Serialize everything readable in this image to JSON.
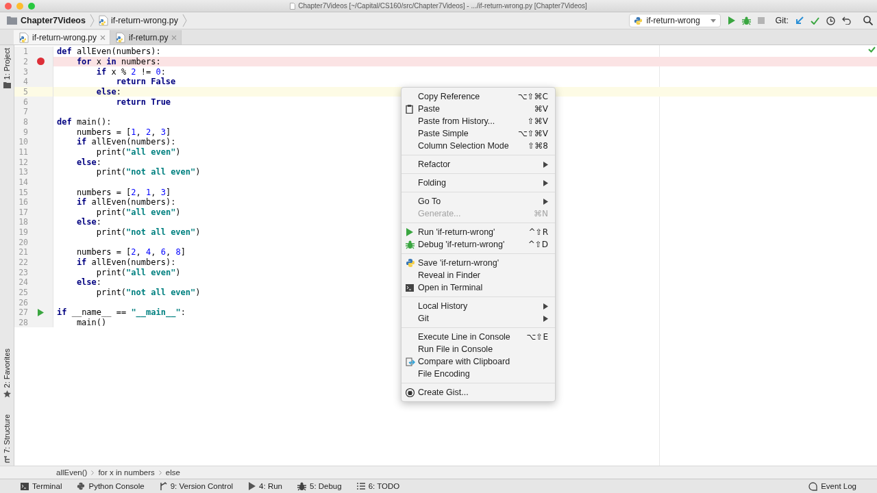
{
  "window": {
    "title": "Chapter7Videos [~/Capital/CS160/src/Chapter7Videos] - .../if-return-wrong.py [Chapter7Videos]"
  },
  "navbar": {
    "crumbs": [
      "Chapter7Videos",
      "if-return-wrong.py"
    ],
    "run_config": "if-return-wrong",
    "git_label": "Git:"
  },
  "tabs": [
    {
      "label": "if-return-wrong.py",
      "selected": true
    },
    {
      "label": "if-return.py",
      "selected": false
    }
  ],
  "side_tools": [
    {
      "kind": "project",
      "label": "1: Project"
    },
    {
      "kind": "favorites",
      "label": "2: Favorites"
    },
    {
      "kind": "structure",
      "label": "7: Structure"
    }
  ],
  "code": [
    {
      "number": "1",
      "tokens": [
        {
          "kind": "kw",
          "text": "def"
        },
        {
          "kind": "plain",
          "text": " allEven(numbers):"
        }
      ],
      "children": [
        {
          "number": "2",
          "breakpoint": true,
          "tokens": [
            {
              "kind": "kw",
              "text": "for"
            },
            {
              "kind": "plain",
              "text": " x "
            },
            {
              "kind": "kw",
              "text": "in"
            },
            {
              "kind": "plain",
              "text": " numbers:"
            }
          ],
          "children": [
            {
              "number": "3",
              "tokens": [
                {
                  "kind": "kw",
                  "text": "if"
                },
                {
                  "kind": "plain",
                  "text": " x % "
                },
                {
                  "kind": "num",
                  "text": "2"
                },
                {
                  "kind": "plain",
                  "text": " != "
                },
                {
                  "kind": "num",
                  "text": "0"
                },
                {
                  "kind": "plain",
                  "text": ":"
                }
              ],
              "children": [
                {
                  "number": "4",
                  "tokens": [
                    {
                      "kind": "kw",
                      "text": "return False"
                    }
                  ]
                }
              ]
            },
            {
              "number": "5",
              "caret_line": true,
              "tokens": [
                {
                  "kind": "kw",
                  "text": "else"
                },
                {
                  "kind": "plain",
                  "text": ":"
                }
              ],
              "children": [
                {
                  "number": "6",
                  "tokens": [
                    {
                      "kind": "kw",
                      "text": "return True"
                    }
                  ]
                }
              ]
            }
          ]
        }
      ]
    },
    {
      "number": "7"
    },
    {
      "number": "8",
      "tokens": [
        {
          "kind": "kw",
          "text": "def"
        },
        {
          "kind": "plain",
          "text": " main():"
        }
      ],
      "children": [
        {
          "number": "9",
          "tokens": [
            {
              "kind": "plain",
              "text": "numbers = ["
            },
            {
              "kind": "num",
              "text": "1"
            },
            {
              "kind": "plain",
              "text": ", "
            },
            {
              "kind": "num",
              "text": "2"
            },
            {
              "kind": "plain",
              "text": ", "
            },
            {
              "kind": "num",
              "text": "3"
            },
            {
              "kind": "plain",
              "text": "]"
            }
          ]
        },
        {
          "number": "10",
          "tokens": [
            {
              "kind": "kw",
              "text": "if"
            },
            {
              "kind": "plain",
              "text": " allEven(numbers):"
            }
          ],
          "children": [
            {
              "number": "11",
              "tokens": [
                {
                  "kind": "plain",
                  "text": "print("
                },
                {
                  "kind": "str",
                  "text": "\"all even\""
                },
                {
                  "kind": "plain",
                  "text": ")"
                }
              ]
            }
          ]
        },
        {
          "number": "12",
          "tokens": [
            {
              "kind": "kw",
              "text": "else"
            },
            {
              "kind": "plain",
              "text": ":"
            }
          ],
          "children": [
            {
              "number": "13",
              "tokens": [
                {
                  "kind": "plain",
                  "text": "print("
                },
                {
                  "kind": "str",
                  "text": "\"not all even\""
                },
                {
                  "kind": "plain",
                  "text": ")"
                }
              ]
            }
          ]
        },
        {
          "number": "14"
        },
        {
          "number": "15",
          "tokens": [
            {
              "kind": "plain",
              "text": "numbers = ["
            },
            {
              "kind": "num",
              "text": "2"
            },
            {
              "kind": "plain",
              "text": ", "
            },
            {
              "kind": "num",
              "text": "1"
            },
            {
              "kind": "plain",
              "text": ", "
            },
            {
              "kind": "num",
              "text": "3"
            },
            {
              "kind": "plain",
              "text": "]"
            }
          ]
        },
        {
          "number": "16",
          "tokens": [
            {
              "kind": "kw",
              "text": "if"
            },
            {
              "kind": "plain",
              "text": " allEven(numbers):"
            }
          ],
          "children": [
            {
              "number": "17",
              "tokens": [
                {
                  "kind": "plain",
                  "text": "print("
                },
                {
                  "kind": "str",
                  "text": "\"all even\""
                },
                {
                  "kind": "plain",
                  "text": ")"
                }
              ]
            }
          ]
        },
        {
          "number": "18",
          "tokens": [
            {
              "kind": "kw",
              "text": "else"
            },
            {
              "kind": "plain",
              "text": ":"
            }
          ],
          "children": [
            {
              "number": "19",
              "tokens": [
                {
                  "kind": "plain",
                  "text": "print("
                },
                {
                  "kind": "str",
                  "text": "\"not all even\""
                },
                {
                  "kind": "plain",
                  "text": ")"
                }
              ]
            }
          ]
        },
        {
          "number": "20"
        },
        {
          "number": "21",
          "tokens": [
            {
              "kind": "plain",
              "text": "numbers = ["
            },
            {
              "kind": "num",
              "text": "2"
            },
            {
              "kind": "plain",
              "text": ", "
            },
            {
              "kind": "num",
              "text": "4"
            },
            {
              "kind": "plain",
              "text": ", "
            },
            {
              "kind": "num",
              "text": "6"
            },
            {
              "kind": "plain",
              "text": ", "
            },
            {
              "kind": "num",
              "text": "8"
            },
            {
              "kind": "plain",
              "text": "]"
            }
          ]
        },
        {
          "number": "22",
          "tokens": [
            {
              "kind": "kw",
              "text": "if"
            },
            {
              "kind": "plain",
              "text": " allEven(numbers):"
            }
          ],
          "children": [
            {
              "number": "23",
              "tokens": [
                {
                  "kind": "plain",
                  "text": "print("
                },
                {
                  "kind": "str",
                  "text": "\"all even\""
                },
                {
                  "kind": "plain",
                  "text": ")"
                }
              ]
            }
          ]
        },
        {
          "number": "24",
          "tokens": [
            {
              "kind": "kw",
              "text": "else"
            },
            {
              "kind": "plain",
              "text": ":"
            }
          ],
          "children": [
            {
              "number": "25",
              "tokens": [
                {
                  "kind": "plain",
                  "text": "print("
                },
                {
                  "kind": "str",
                  "text": "\"not all even\""
                },
                {
                  "kind": "plain",
                  "text": ")"
                }
              ]
            }
          ]
        }
      ]
    },
    {
      "number": "26"
    },
    {
      "number": "27",
      "run_gutter": true,
      "tokens": [
        {
          "kind": "kw",
          "text": "if"
        },
        {
          "kind": "plain",
          "text": " __name__ == "
        },
        {
          "kind": "str",
          "text": "\"__main__\""
        },
        {
          "kind": "plain",
          "text": ":"
        }
      ],
      "children": [
        {
          "number": "28",
          "tokens": [
            {
              "kind": "plain",
              "text": "main()"
            }
          ]
        }
      ]
    }
  ],
  "context_menu": {
    "groups": [
      {
        "items": [
          {
            "kind": "plain",
            "label": "Copy Reference",
            "shortcut": "⌥⇧⌘C",
            "submenu": false,
            "disabled": false
          },
          {
            "kind": "paste",
            "label": "Paste",
            "shortcut": "⌘V",
            "submenu": false,
            "disabled": false
          },
          {
            "kind": "plain",
            "label": "Paste from History...",
            "shortcut": "⇧⌘V",
            "submenu": false,
            "disabled": false
          },
          {
            "kind": "plain",
            "label": "Paste Simple",
            "shortcut": "⌥⇧⌘V",
            "submenu": false,
            "disabled": false
          },
          {
            "kind": "plain",
            "label": "Column Selection Mode",
            "shortcut": "⇧⌘8",
            "submenu": false,
            "disabled": false
          }
        ]
      },
      {
        "items": [
          {
            "kind": "plain",
            "label": "Refactor",
            "submenu": true,
            "disabled": false
          }
        ]
      },
      {
        "items": [
          {
            "kind": "plain",
            "label": "Folding",
            "submenu": true,
            "disabled": false
          }
        ]
      },
      {
        "items": [
          {
            "kind": "plain",
            "label": "Go To",
            "submenu": true,
            "disabled": false
          },
          {
            "kind": "plain",
            "label": "Generate...",
            "shortcut": "⌘N",
            "submenu": false,
            "disabled": true
          }
        ]
      },
      {
        "items": [
          {
            "kind": "run",
            "label": "Run 'if-return-wrong'",
            "shortcut": "^⇧R",
            "submenu": false,
            "disabled": false
          },
          {
            "kind": "debug",
            "label": "Debug 'if-return-wrong'",
            "shortcut": "^⇧D",
            "submenu": false,
            "disabled": false
          }
        ]
      },
      {
        "items": [
          {
            "kind": "python",
            "label": "Save 'if-return-wrong'",
            "submenu": false,
            "disabled": false
          },
          {
            "kind": "plain",
            "label": "Reveal in Finder",
            "submenu": false,
            "disabled": false
          },
          {
            "kind": "terminal",
            "label": "Open in Terminal",
            "submenu": false,
            "disabled": false
          }
        ]
      },
      {
        "items": [
          {
            "kind": "plain",
            "label": "Local History",
            "submenu": true,
            "disabled": false
          },
          {
            "kind": "plain",
            "label": "Git",
            "submenu": true,
            "disabled": false
          }
        ]
      },
      {
        "items": [
          {
            "kind": "plain",
            "label": "Execute Line in Console",
            "shortcut": "⌥⇧E",
            "submenu": false,
            "disabled": false
          },
          {
            "kind": "plain",
            "label": "Run File in Console",
            "submenu": false,
            "disabled": false
          },
          {
            "kind": "compare",
            "label": "Compare with Clipboard",
            "submenu": false,
            "disabled": false
          },
          {
            "kind": "plain",
            "label": "File Encoding",
            "submenu": false,
            "disabled": false
          }
        ]
      },
      {
        "items": [
          {
            "kind": "gist",
            "label": "Create Gist...",
            "submenu": false,
            "disabled": false
          }
        ]
      }
    ]
  },
  "breadcrumbs": [
    "allEven()",
    "for x in numbers",
    "else"
  ],
  "tool_windows": [
    {
      "kind": "terminal",
      "label": "Terminal"
    },
    {
      "kind": "python",
      "label": "Python Console"
    },
    {
      "kind": "vcs",
      "label": "9: Version Control"
    },
    {
      "kind": "run",
      "label": "4: Run"
    },
    {
      "kind": "debug",
      "label": "5: Debug"
    },
    {
      "kind": "todo",
      "label": "6: TODO"
    }
  ],
  "event_log": "Event Log"
}
